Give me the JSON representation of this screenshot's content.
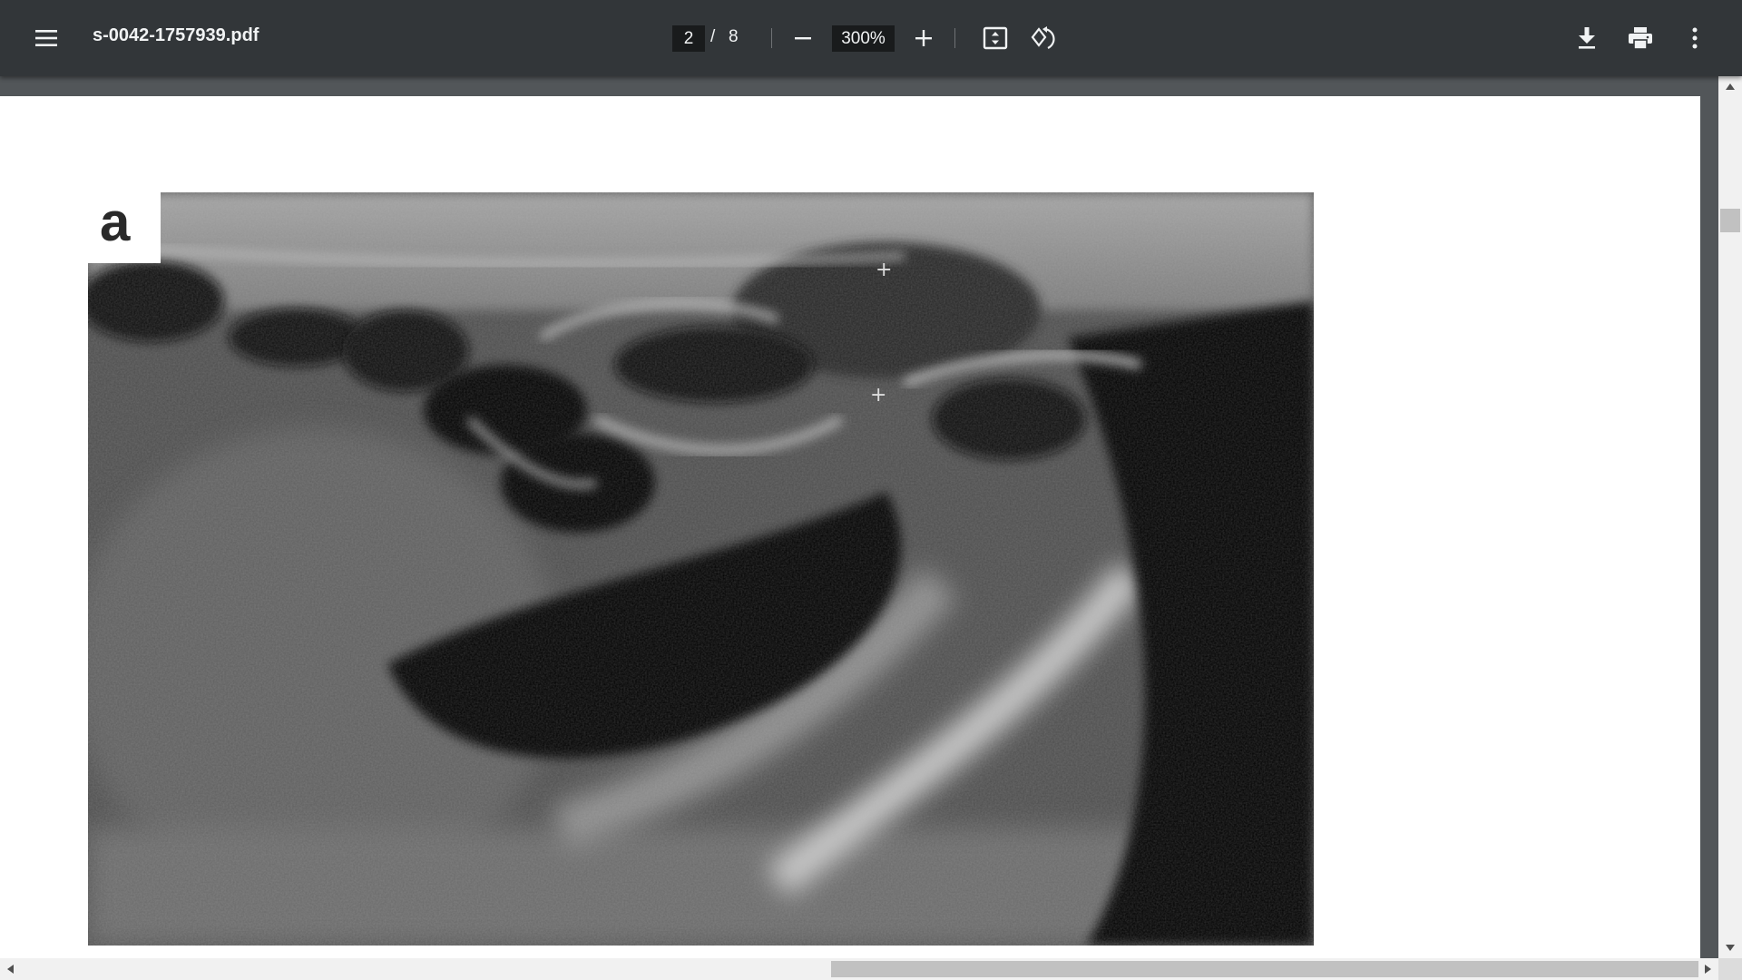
{
  "toolbar": {
    "menu_icon": "hamburger-menu-icon",
    "file_name": "s-0042-1757939.pdf",
    "current_page": "2",
    "page_separator": "/",
    "total_pages": "8",
    "zoom_level": "300%",
    "zoom_out_icon": "minus-icon",
    "zoom_in_icon": "plus-icon",
    "fit_icon": "fit-to-page-icon",
    "rotate_icon": "rotate-counterclockwise-icon",
    "download_icon": "download-icon",
    "print_icon": "print-icon",
    "more_icon": "more-vertical-icon"
  },
  "document": {
    "figure_label": "a",
    "figure_description_icon": "ultrasound-image"
  },
  "colors": {
    "toolbar_bg": "#323639",
    "viewer_bg": "#525659",
    "page_bg": "#ffffff"
  }
}
